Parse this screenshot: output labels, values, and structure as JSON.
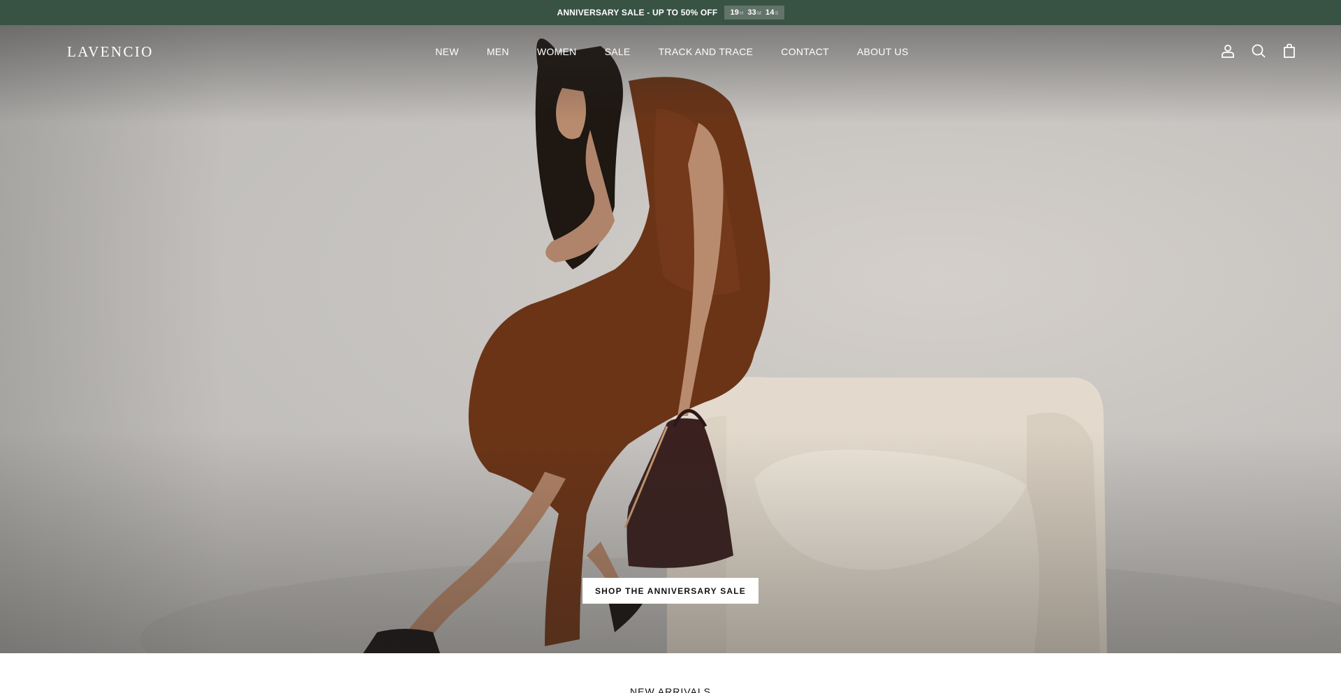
{
  "announcement": {
    "text": "ANNIVERSARY SALE - UP TO 50% OFF",
    "countdown": [
      {
        "value": "19",
        "unit": "H"
      },
      {
        "value": "33",
        "unit": "M"
      },
      {
        "value": "14",
        "unit": "S"
      }
    ]
  },
  "header": {
    "logo": "LAVENCIO",
    "nav": [
      "NEW",
      "MEN",
      "WOMEN",
      "SALE",
      "TRACK AND TRACE",
      "CONTACT",
      "ABOUT US"
    ],
    "icons": [
      "account-icon",
      "search-icon",
      "cart-icon"
    ]
  },
  "hero": {
    "cta_label": "SHOP THE ANNIVERSARY SALE"
  },
  "sections": {
    "new_arrivals_title": "NEW ARRIVALS"
  },
  "colors": {
    "announcement_bg": "#385244",
    "countdown_bg": "#62746a",
    "dress": "#6b3417",
    "chair": "#e6ddd0"
  }
}
